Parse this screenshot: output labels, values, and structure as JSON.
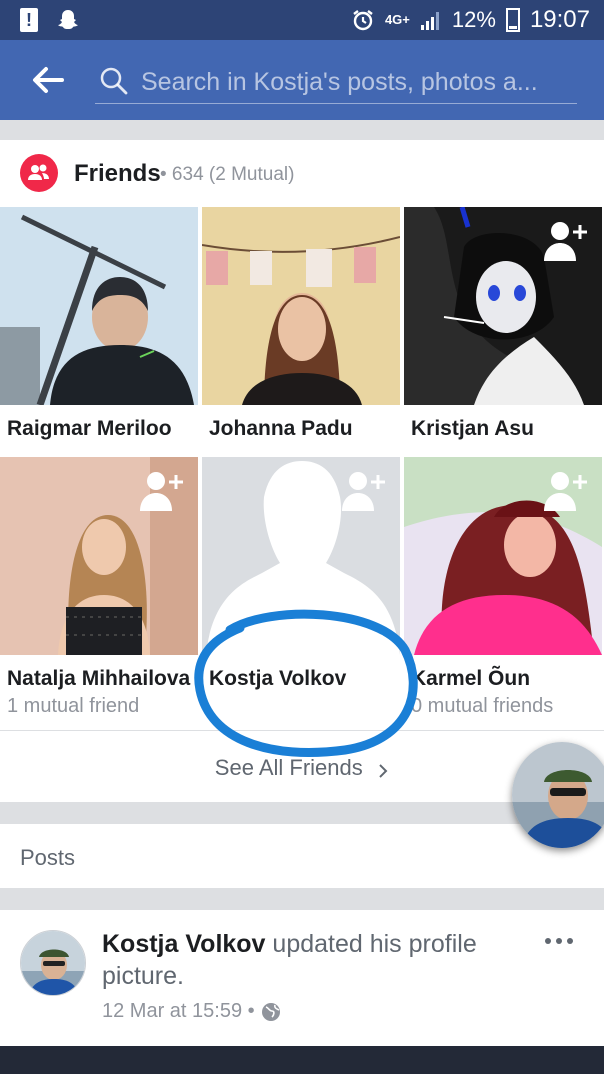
{
  "status_bar": {
    "network": "4G+",
    "battery": "12%",
    "time": "19:07"
  },
  "nav": {
    "search_placeholder": "Search in Kostja's posts, photos a..."
  },
  "friends": {
    "title": "Friends",
    "count": "• 634 (2 Mutual)",
    "see_all": "See All Friends",
    "tiles": [
      {
        "name": "Raigmar Meriloo",
        "mutual": ""
      },
      {
        "name": "Johanna Padu",
        "mutual": ""
      },
      {
        "name": "Kristjan Asu",
        "mutual": ""
      },
      {
        "name": "Natalja Mihhailova",
        "mutual": "1 mutual friend"
      },
      {
        "name": "Kostja Volkov",
        "mutual": ""
      },
      {
        "name": "Karmel Õun",
        "mutual": "0 mutual friends"
      }
    ]
  },
  "posts": {
    "title": "Posts"
  },
  "post": {
    "author": "Kostja Volkov",
    "action": " updated his profile picture.",
    "timestamp": "12 Mar at 15:59 •"
  },
  "colors": {
    "brand": "#4267b2",
    "status_bar": "#2d4476",
    "friends_badge": "#f02849",
    "annotation": "#1a7fd6"
  }
}
